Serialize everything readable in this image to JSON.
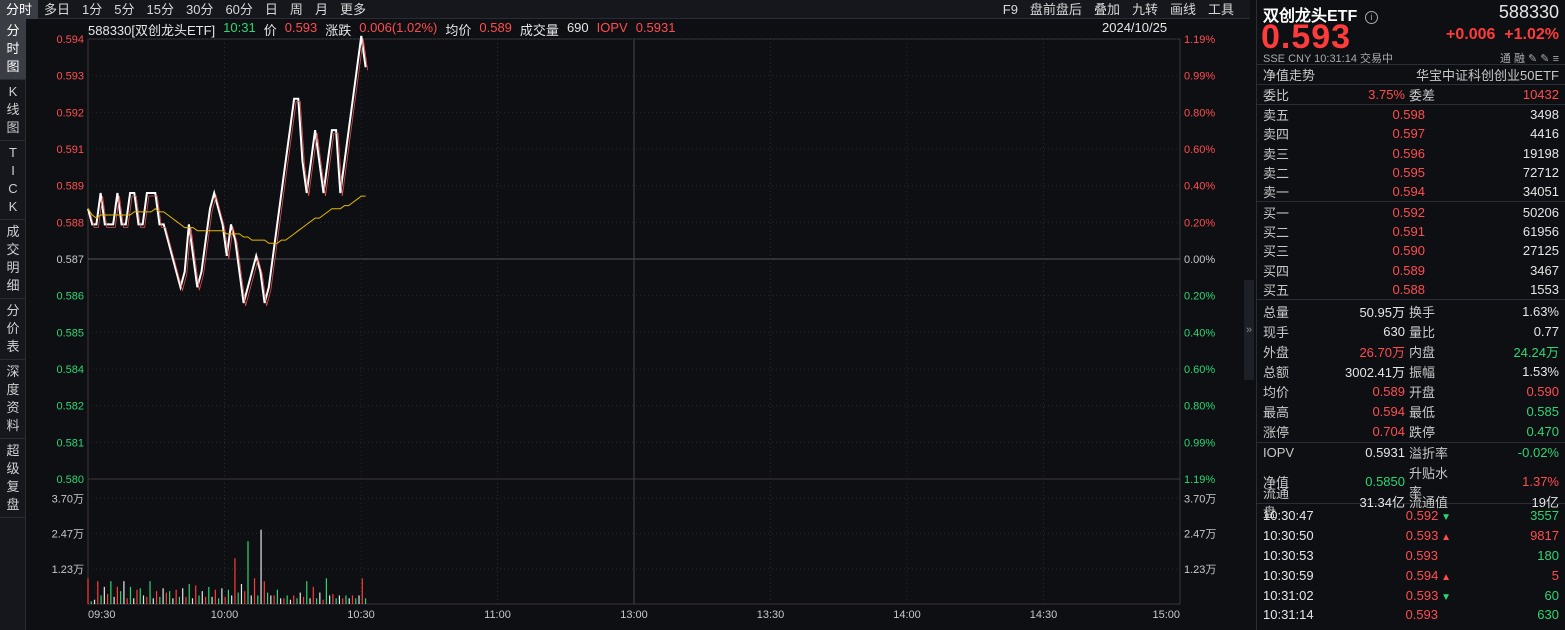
{
  "toolbar": {
    "tabs": [
      "分时",
      "多日",
      "1分",
      "5分",
      "15分",
      "30分",
      "60分",
      "日",
      "周",
      "月",
      "更多"
    ],
    "right": [
      "F9",
      "盘前盘后",
      "叠加",
      "九转",
      "画线",
      "工具"
    ]
  },
  "sidebar": [
    {
      "label": "分时图",
      "chars": [
        "分",
        "时",
        "图"
      ]
    },
    {
      "label": "K线图",
      "chars": [
        "K",
        "线",
        "图"
      ]
    },
    {
      "label": "TICK",
      "chars": [
        "T",
        "I",
        "C",
        "K"
      ]
    },
    {
      "label": "成交明细",
      "chars": [
        "成",
        "交",
        "明",
        "细"
      ]
    },
    {
      "label": "分价表",
      "chars": [
        "分",
        "价",
        "表"
      ]
    },
    {
      "label": "深度资料",
      "chars": [
        "深",
        "度",
        "资",
        "料"
      ]
    },
    {
      "label": "超级复盘",
      "chars": [
        "超",
        "级",
        "复",
        "盘"
      ]
    }
  ],
  "info": {
    "name": "588330[双创龙头ETF]",
    "time": "10:31",
    "price_label": "价",
    "price": "0.593",
    "chg_label": "涨跌",
    "chg": "0.006(1.02%)",
    "avg_label": "均价",
    "avg": "0.589",
    "vol_label": "成交量",
    "vol": "690",
    "iopv_label": "IOPV",
    "iopv": "0.5931",
    "date": "2024/10/25"
  },
  "axis": {
    "left_prices": [
      "0.594",
      "0.593",
      "0.592",
      "0.591",
      "0.589",
      "0.588",
      "0.587",
      "0.586",
      "0.585",
      "0.584",
      "0.582",
      "0.581",
      "0.580"
    ],
    "right_pct": [
      "1.19%",
      "0.99%",
      "0.80%",
      "0.60%",
      "0.40%",
      "0.20%",
      "0.00%",
      "0.20%",
      "0.40%",
      "0.60%",
      "0.80%",
      "0.99%",
      "1.19%"
    ],
    "vol_labels": [
      "3.70万",
      "2.47万",
      "1.23万"
    ],
    "times": [
      "09:30",
      "10:00",
      "10:30",
      "11:00",
      "13:00",
      "13:30",
      "14:00",
      "14:30",
      "15:00"
    ]
  },
  "chart_data": {
    "type": "line",
    "title": "",
    "prev_close": 0.587,
    "price": [
      0.5886,
      0.5881,
      0.5881,
      0.5891,
      0.5881,
      0.5881,
      0.5881,
      0.5891,
      0.5881,
      0.5881,
      0.5891,
      0.5891,
      0.5881,
      0.5881,
      0.5891,
      0.5891,
      0.5891,
      0.5881,
      0.5881,
      0.5876,
      0.5871,
      0.5866,
      0.5861,
      0.5866,
      0.5881,
      0.5871,
      0.5861,
      0.5866,
      0.5876,
      0.5886,
      0.5891,
      0.5886,
      0.5881,
      0.5871,
      0.5881,
      0.5876,
      0.5866,
      0.5856,
      0.5861,
      0.5866,
      0.5871,
      0.5866,
      0.5856,
      0.5861,
      0.5871,
      0.5881,
      0.5891,
      0.5901,
      0.5911,
      0.5921,
      0.5921,
      0.5901,
      0.5891,
      0.5901,
      0.5911,
      0.5901,
      0.5891,
      0.5901,
      0.5911,
      0.5911,
      0.5891,
      0.5901,
      0.5911,
      0.5921,
      0.5931,
      0.5941,
      0.5931
    ],
    "avg": [
      0.5886,
      0.5884,
      0.5883,
      0.5884,
      0.5884,
      0.5884,
      0.5884,
      0.5884,
      0.5884,
      0.5884,
      0.5884,
      0.5885,
      0.5885,
      0.5885,
      0.5885,
      0.5885,
      0.5886,
      0.5885,
      0.5885,
      0.5884,
      0.5883,
      0.5882,
      0.5881,
      0.588,
      0.588,
      0.588,
      0.5879,
      0.5879,
      0.5879,
      0.5879,
      0.5879,
      0.5879,
      0.5879,
      0.5878,
      0.5878,
      0.5878,
      0.5878,
      0.5877,
      0.5877,
      0.5876,
      0.5876,
      0.5876,
      0.5876,
      0.5875,
      0.5875,
      0.5875,
      0.5876,
      0.5876,
      0.5877,
      0.5878,
      0.5879,
      0.588,
      0.5881,
      0.5882,
      0.5883,
      0.5883,
      0.5884,
      0.5885,
      0.5886,
      0.5886,
      0.5886,
      0.5887,
      0.5887,
      0.5888,
      0.5889,
      0.589,
      0.589
    ],
    "volume": [
      0.9,
      0.1,
      0.15,
      0.8,
      0.3,
      0.6,
      0.35,
      0.8,
      0.25,
      0.6,
      0.45,
      0.8,
      0.2,
      0.6,
      0.2,
      0.5,
      0.55,
      0.3,
      0.25,
      0.8,
      0.2,
      0.45,
      0.25,
      0.55,
      0.4,
      0.45,
      0.2,
      0.5,
      0.25,
      0.55,
      0.25,
      0.7,
      0.2,
      0.65,
      0.3,
      0.45,
      0.25,
      0.6,
      0.25,
      0.5,
      0.2,
      0.55,
      0.25,
      0.5,
      0.3,
      1.6,
      0.4,
      0.7,
      0.45,
      2.2,
      0.3,
      0.9,
      0.3,
      2.6,
      0.8,
      0.4,
      0.3,
      0.3,
      0.5,
      0.2,
      0.2,
      0.3,
      0.15,
      0.3,
      0.2,
      0.4,
      0.25,
      0.8,
      0.2,
      0.6,
      0.2,
      0.4,
      0.15,
      0.9,
      0.3,
      0.35,
      0.2,
      0.3,
      0.2,
      0.3,
      0.2,
      0.3,
      0.2,
      0.3,
      0.9,
      0.2
    ],
    "vol_colors": "mixed",
    "ylim": [
      0.58,
      0.594
    ],
    "vol_max": 4.2
  },
  "panel": {
    "name": "双创龙头ETF",
    "code": "588330",
    "price": "0.593",
    "chg": "+0.006",
    "pct": "+1.02%",
    "sub": "SSE  CNY  10:31:14  交易中",
    "tags": "通  融",
    "nav_trend": "净值走势",
    "index": "华宝中证科创创业50ETF",
    "wb": {
      "l1": "委比",
      "v1": "3.75%",
      "l2": "委差",
      "v2": "10432"
    },
    "sells": [
      {
        "label": "卖五",
        "price": "0.598",
        "vol": "3498"
      },
      {
        "label": "卖四",
        "price": "0.597",
        "vol": "4416"
      },
      {
        "label": "卖三",
        "price": "0.596",
        "vol": "19198"
      },
      {
        "label": "卖二",
        "price": "0.595",
        "vol": "72712"
      },
      {
        "label": "卖一",
        "price": "0.594",
        "vol": "34051"
      }
    ],
    "buys": [
      {
        "label": "买一",
        "price": "0.592",
        "vol": "50206"
      },
      {
        "label": "买二",
        "price": "0.591",
        "vol": "61956"
      },
      {
        "label": "买三",
        "price": "0.590",
        "vol": "27125"
      },
      {
        "label": "买四",
        "price": "0.589",
        "vol": "3467"
      },
      {
        "label": "买五",
        "price": "0.588",
        "vol": "1553"
      }
    ],
    "stats": [
      [
        "总量",
        "50.95万",
        "white",
        "换手",
        "1.63%",
        "white"
      ],
      [
        "现手",
        "630",
        "white",
        "量比",
        "0.77",
        "white"
      ],
      [
        "外盘",
        "26.70万",
        "red",
        "内盘",
        "24.24万",
        "green"
      ],
      [
        "总额",
        "3002.41万",
        "white",
        "振幅",
        "1.53%",
        "white"
      ],
      [
        "均价",
        "0.589",
        "red",
        "开盘",
        "0.590",
        "red"
      ],
      [
        "最高",
        "0.594",
        "red",
        "最低",
        "0.585",
        "green"
      ],
      [
        "涨停",
        "0.704",
        "red",
        "跌停",
        "0.470",
        "green"
      ]
    ],
    "stats2": [
      [
        "IOPV",
        "0.5931",
        "white",
        "溢折率",
        "-0.02%",
        "green"
      ],
      [
        "净值",
        "0.5850",
        "green",
        "升贴水率",
        "1.37%",
        "red"
      ],
      [
        "流通盘",
        "31.34亿",
        "white",
        "流通值",
        "19亿",
        "white"
      ]
    ],
    "ticks": [
      {
        "time": "10:30:47",
        "price": "0.592",
        "dir": "down",
        "vol": "3557",
        "vcolor": "green"
      },
      {
        "time": "10:30:50",
        "price": "0.593",
        "dir": "up",
        "vol": "9817",
        "vcolor": "red"
      },
      {
        "time": "10:30:53",
        "price": "0.593",
        "dir": "",
        "vol": "180",
        "vcolor": "green"
      },
      {
        "time": "10:30:59",
        "price": "0.594",
        "dir": "up",
        "vol": "5",
        "vcolor": "red"
      },
      {
        "time": "10:31:02",
        "price": "0.593",
        "dir": "down",
        "vol": "60",
        "vcolor": "green"
      },
      {
        "time": "10:31:14",
        "price": "0.593",
        "dir": "",
        "vol": "630",
        "vcolor": "green"
      }
    ]
  }
}
